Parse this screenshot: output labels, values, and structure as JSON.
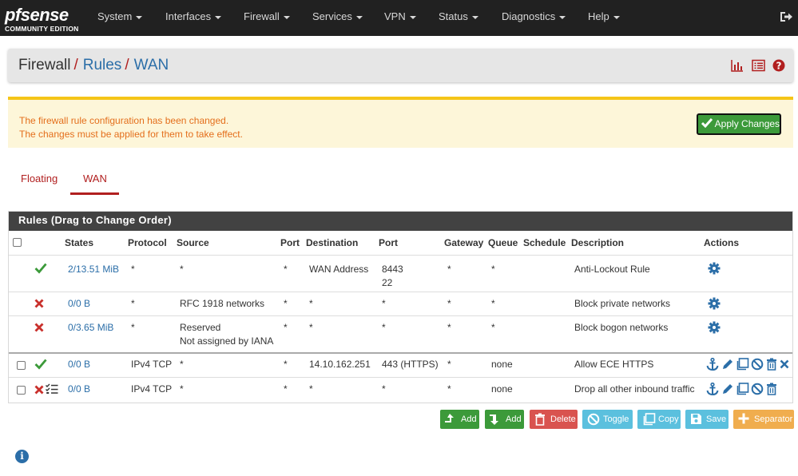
{
  "brand": {
    "name": "pfsense",
    "edition": "COMMUNITY EDITION"
  },
  "nav": [
    "System",
    "Interfaces",
    "Firewall",
    "Services",
    "VPN",
    "Status",
    "Diagnostics",
    "Help"
  ],
  "breadcrumb": {
    "first": "Firewall",
    "second": "Rules",
    "third": "WAN"
  },
  "alert": {
    "line1": "The firewall rule configuration has been changed.",
    "line2": "The changes must be applied for them to take effect.",
    "button": "Apply Changes"
  },
  "tabs": [
    "Floating",
    "WAN"
  ],
  "panel_title": "Rules (Drag to Change Order)",
  "columns": {
    "states": "States",
    "protocol": "Protocol",
    "source": "Source",
    "port": "Port",
    "destination": "Destination",
    "dport": "Port",
    "gateway": "Gateway",
    "queue": "Queue",
    "schedule": "Schedule",
    "description": "Description",
    "actions": "Actions"
  },
  "rules": [
    {
      "status": "pass",
      "states": "2/13.51 MiB",
      "protocol": "*",
      "source": "*",
      "source2": "",
      "port": "*",
      "destination": "WAN Address",
      "dport": "8443",
      "dport2": "22",
      "gateway": "*",
      "queue": "*",
      "schedule": "",
      "description": "Anti-Lockout Rule"
    },
    {
      "status": "block",
      "states": "0/0 B",
      "protocol": "*",
      "source": "RFC 1918 networks",
      "source2": "",
      "port": "*",
      "destination": "*",
      "dport": "*",
      "dport2": "",
      "gateway": "*",
      "queue": "*",
      "schedule": "",
      "description": "Block private networks"
    },
    {
      "status": "block",
      "states": "0/3.65 MiB",
      "protocol": "*",
      "source": "Reserved",
      "source2": "Not assigned by IANA",
      "port": "*",
      "destination": "*",
      "dport": "*",
      "dport2": "",
      "gateway": "*",
      "queue": "*",
      "schedule": "",
      "description": "Block bogon networks"
    },
    {
      "status": "pass",
      "states": "0/0 B",
      "protocol": "IPv4 TCP",
      "source": "*",
      "source2": "",
      "port": "*",
      "destination": "14.10.162.251",
      "dport": "443 (HTTPS)",
      "dport2": "",
      "gateway": "*",
      "queue": "none",
      "schedule": "",
      "description": "Allow ECE HTTPS"
    },
    {
      "status": "block-log",
      "states": "0/0 B",
      "protocol": "IPv4 TCP",
      "source": "*",
      "source2": "",
      "port": "*",
      "destination": "*",
      "dport": "*",
      "dport2": "",
      "gateway": "*",
      "queue": "none",
      "schedule": "",
      "description": "Drop all other inbound traffic"
    }
  ],
  "buttons": {
    "add_top": "Add",
    "add_bottom": "Add",
    "delete": "Delete",
    "toggle": "Toggle",
    "copy": "Copy",
    "save": "Save",
    "separator": "Separator"
  },
  "colors": {
    "navbar": "#212121",
    "accent_red": "#b11f1f",
    "link_blue": "#2b6ea8",
    "green": "#3c9a3a",
    "red_btn": "#d9534f",
    "blue_btn": "#5bc0de",
    "orange_btn": "#f0ad4e",
    "warning_text": "#e46f1c"
  }
}
